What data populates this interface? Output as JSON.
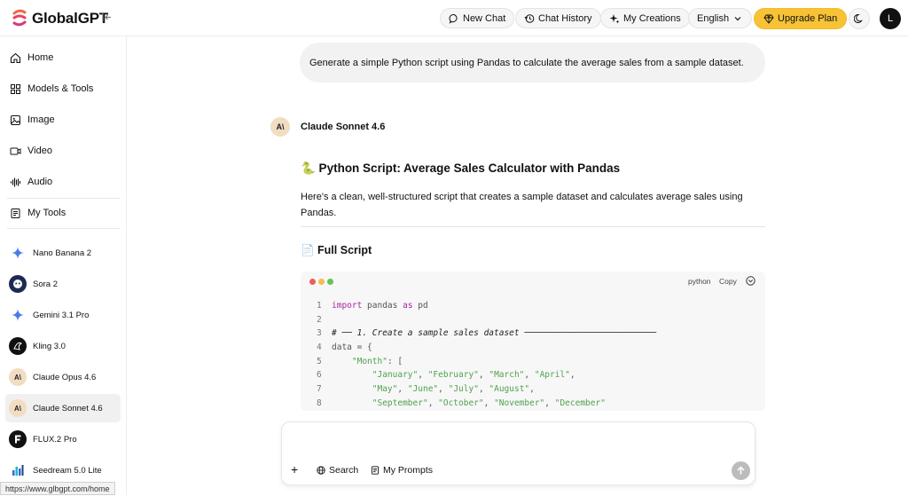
{
  "header": {
    "brand": "GlobalGPT",
    "new_chat": "New Chat",
    "chat_history": "Chat History",
    "my_creations": "My Creations",
    "language": "English",
    "upgrade": "Upgrade Plan",
    "avatar_initial": "L"
  },
  "sidebar": {
    "nav": [
      {
        "label": "Home",
        "icon": "home-icon"
      },
      {
        "label": "Models & Tools",
        "icon": "grid-icon"
      },
      {
        "label": "Image",
        "icon": "image-icon"
      },
      {
        "label": "Video",
        "icon": "video-icon"
      },
      {
        "label": "Audio",
        "icon": "audio-wave-icon"
      },
      {
        "label": "My Tools",
        "icon": "document-icon"
      }
    ],
    "models": [
      {
        "label": "Nano Banana 2",
        "icon": "sparkle-icon"
      },
      {
        "label": "Sora 2",
        "icon": "sora-icon"
      },
      {
        "label": "Gemini 3.1 Pro",
        "icon": "sparkle-icon"
      },
      {
        "label": "Kling 3.0",
        "icon": "kling-icon"
      },
      {
        "label": "Claude Opus 4.6",
        "icon": "anthropic-icon"
      },
      {
        "label": "Claude Sonnet 4.6",
        "icon": "anthropic-icon"
      },
      {
        "label": "FLUX.2 Pro",
        "icon": "flux-icon"
      },
      {
        "label": "Seedream 5.0 Lite",
        "icon": "seedream-icon"
      }
    ],
    "url_tooltip": "https://www.glbgpt.com/home"
  },
  "chat": {
    "user_message": "Generate a simple Python script using Pandas to calculate the average sales from a sample dataset.",
    "bot_name": "Claude Sonnet 4.6",
    "bot_avatar": "A\\",
    "heading": "🐍 Python Script: Average Sales Calculator with Pandas",
    "intro": "Here's a clean, well-structured script that creates a sample dataset and calculates average sales using Pandas.",
    "section": "📄 Full Script",
    "code": {
      "language": "python",
      "copy_label": "Copy",
      "lines": [
        {
          "n": "1",
          "tokens": [
            {
              "t": "import",
              "c": "kw"
            },
            {
              "t": " pandas ",
              "c": "var"
            },
            {
              "t": "as",
              "c": "kw"
            },
            {
              "t": " pd",
              "c": "var"
            }
          ]
        },
        {
          "n": "2",
          "tokens": [
            {
              "t": "",
              "c": "var"
            }
          ]
        },
        {
          "n": "3",
          "tokens": [
            {
              "t": "# ── 1. Create a sample sales dataset ──────────────────────────",
              "c": "cm"
            }
          ]
        },
        {
          "n": "4",
          "tokens": [
            {
              "t": "data = {",
              "c": "var"
            }
          ]
        },
        {
          "n": "5",
          "tokens": [
            {
              "t": "    ",
              "c": "var"
            },
            {
              "t": "\"Month\"",
              "c": "str"
            },
            {
              "t": ": [",
              "c": "var"
            }
          ]
        },
        {
          "n": "6",
          "tokens": [
            {
              "t": "        ",
              "c": "var"
            },
            {
              "t": "\"January\"",
              "c": "str"
            },
            {
              "t": ", ",
              "c": "var"
            },
            {
              "t": "\"February\"",
              "c": "str"
            },
            {
              "t": ", ",
              "c": "var"
            },
            {
              "t": "\"March\"",
              "c": "str"
            },
            {
              "t": ", ",
              "c": "var"
            },
            {
              "t": "\"April\"",
              "c": "str"
            },
            {
              "t": ",",
              "c": "var"
            }
          ]
        },
        {
          "n": "7",
          "tokens": [
            {
              "t": "        ",
              "c": "var"
            },
            {
              "t": "\"May\"",
              "c": "str"
            },
            {
              "t": ", ",
              "c": "var"
            },
            {
              "t": "\"June\"",
              "c": "str"
            },
            {
              "t": ", ",
              "c": "var"
            },
            {
              "t": "\"July\"",
              "c": "str"
            },
            {
              "t": ", ",
              "c": "var"
            },
            {
              "t": "\"August\"",
              "c": "str"
            },
            {
              "t": ",",
              "c": "var"
            }
          ]
        },
        {
          "n": "8",
          "tokens": [
            {
              "t": "        ",
              "c": "var"
            },
            {
              "t": "\"September\"",
              "c": "str"
            },
            {
              "t": ", ",
              "c": "var"
            },
            {
              "t": "\"October\"",
              "c": "str"
            },
            {
              "t": ", ",
              "c": "var"
            },
            {
              "t": "\"November\"",
              "c": "str"
            },
            {
              "t": ", ",
              "c": "var"
            },
            {
              "t": "\"December\"",
              "c": "str"
            }
          ]
        }
      ]
    }
  },
  "composer": {
    "search": "Search",
    "my_prompts": "My Prompts"
  },
  "colors": {
    "accent": "#f7c236",
    "code_keyword": "#a626a4",
    "code_string": "#50a14f",
    "dot_red": "#ed5f56",
    "dot_yellow": "#f5bd4f",
    "dot_green": "#61c554"
  }
}
